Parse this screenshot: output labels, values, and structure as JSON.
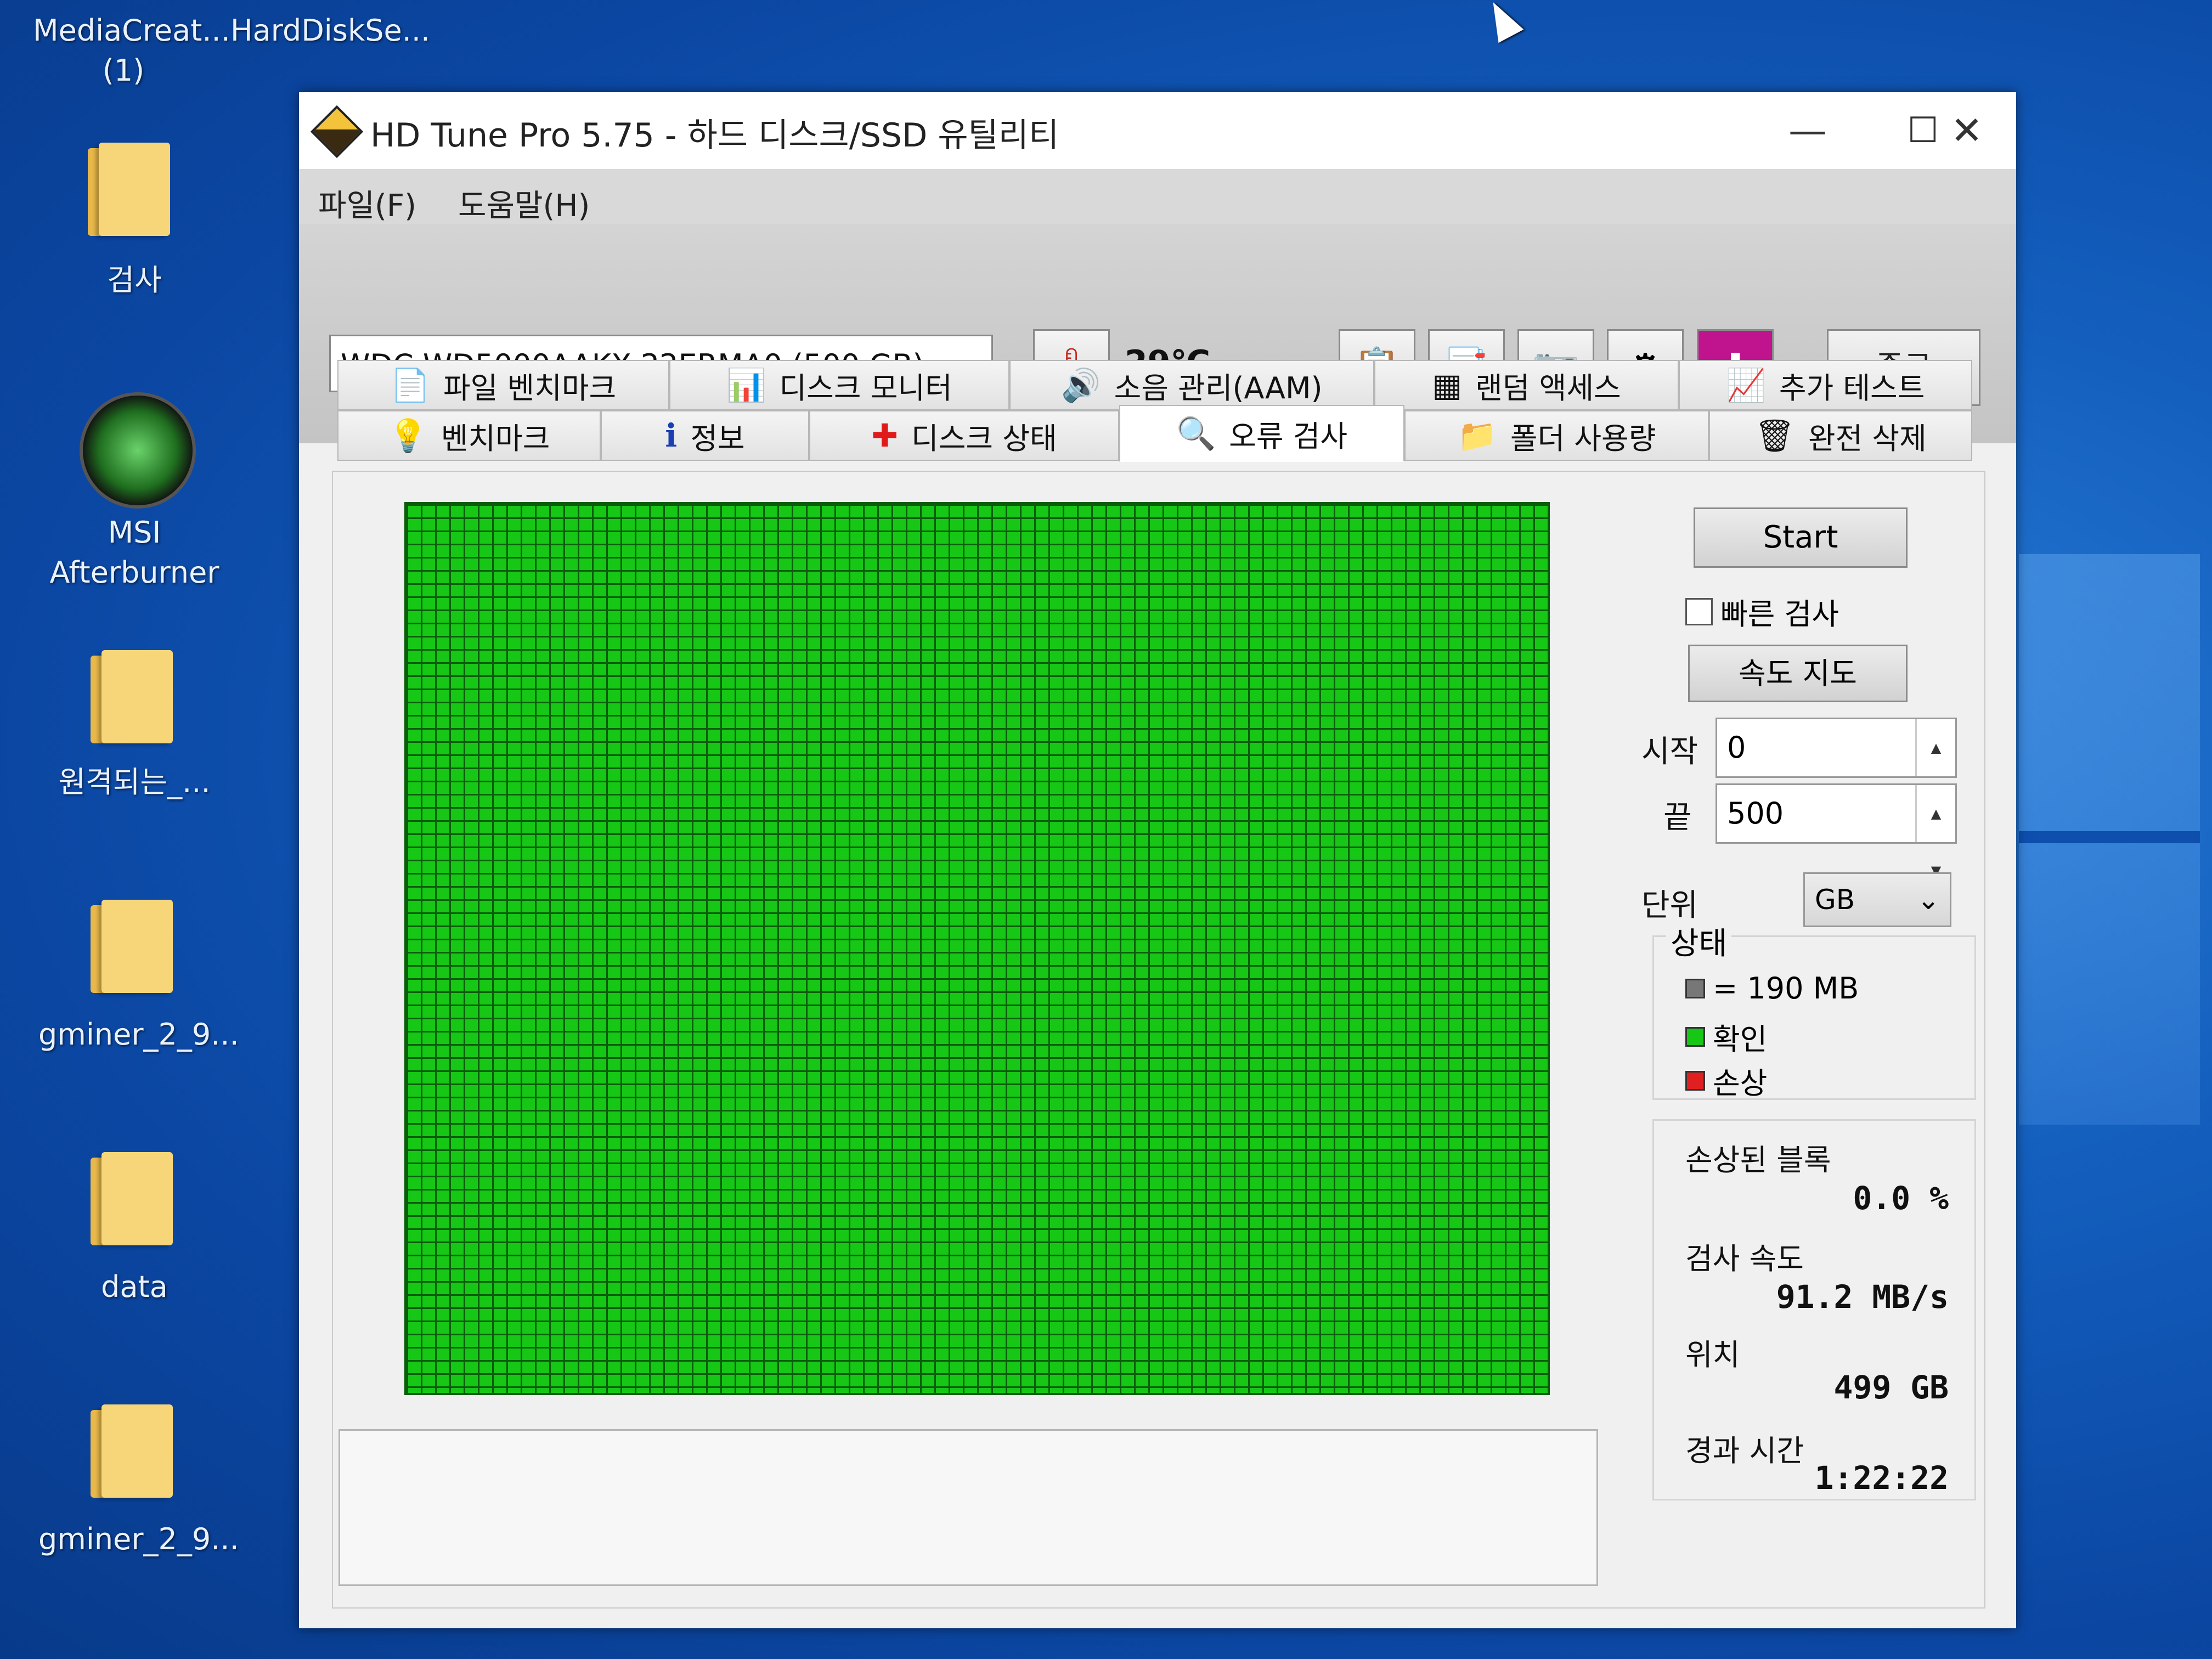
{
  "desktop": {
    "icons": [
      {
        "label": "MediaCreat...\n(1)"
      },
      {
        "label": "HardDiskSe..."
      },
      {
        "label": "검사"
      },
      {
        "label": "MSI\nAfterburner"
      },
      {
        "label": "원격되는_..."
      },
      {
        "label": "gminer_2_9..."
      },
      {
        "label": "data"
      },
      {
        "label": "gminer_2_9..."
      }
    ]
  },
  "window": {
    "title": "HD Tune Pro 5.75 - 하드 디스크/SSD 유틸리티",
    "controls": {
      "minimize": "—",
      "maximize": "☐",
      "close": "✕"
    },
    "menu": [
      "파일(F)",
      "도움말(H)"
    ],
    "drive": "WDC WD5000AAKX-22ERMA0 (500 GB)",
    "temperature": "29℃",
    "exit_label": "종료",
    "tabs_row1": [
      "파일 벤치마크",
      "디스크 모니터",
      "소음 관리(AAM)",
      "랜덤 액세스",
      "추가 테스트"
    ],
    "tabs_row2": [
      "벤치마크",
      "정보",
      "디스크 상태",
      "오류 검사",
      "폴더 사용량",
      "완전 삭제"
    ],
    "active_tab": "오류 검사"
  },
  "scan": {
    "start_label": "Start",
    "quick_scan_label": "빠른 검사",
    "quick_scan_checked": false,
    "speed_map_label": "속도 지도",
    "start_field_label": "시작",
    "start_value": "0",
    "end_field_label": "끝",
    "end_value": "500",
    "unit_label": "단위",
    "unit_value": "GB",
    "legend_title": "상태",
    "legend": [
      {
        "label": "= 190 MB",
        "color": "#777777"
      },
      {
        "label": "확인",
        "color": "#16c716"
      },
      {
        "label": "손상",
        "color": "#e02020"
      }
    ],
    "damaged_blocks_label": "손상된 블록",
    "damaged_blocks_value": "0.0 %",
    "scan_speed_label": "검사 속도",
    "scan_speed_value": "91.2 MB/s",
    "position_label": "위치",
    "position_value": "499 GB",
    "elapsed_label": "경과 시간",
    "elapsed_value": "1:22:22",
    "grid_color": "#16c716"
  }
}
